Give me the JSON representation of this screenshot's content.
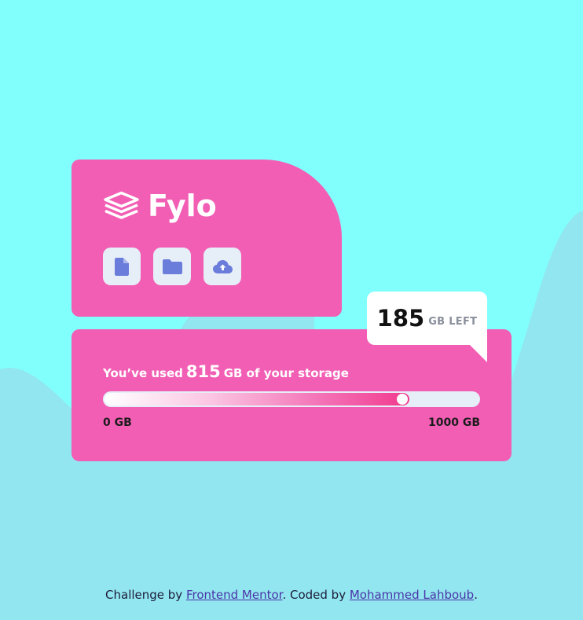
{
  "brand": {
    "name": "Fylo",
    "logo_icon": "stack-layers-icon"
  },
  "toolbar": {
    "buttons": [
      {
        "icon": "document-icon"
      },
      {
        "icon": "folder-icon"
      },
      {
        "icon": "cloud-upload-icon"
      }
    ]
  },
  "storage": {
    "prefix": "You’ve used",
    "used_value": "815",
    "suffix": "GB of your storage",
    "min_label": "0 GB",
    "max_label": "1000 GB",
    "used_fraction": 0.815
  },
  "callout": {
    "value": "185",
    "unit": "GB LEFT"
  },
  "footer": {
    "text_before": "Challenge by ",
    "link1": "Frontend Mentor",
    "text_middle": ". Coded by ",
    "link2": "Mohammed Lahboub",
    "text_after": "."
  },
  "colors": {
    "page_bg": "#81fffd",
    "wave": "#92e6ef",
    "card_pink": "#f25eb4",
    "icon_bg": "#e6eef8",
    "icon_blue": "#6a7ddb",
    "bar_gradient_end": "#f23a8e"
  }
}
